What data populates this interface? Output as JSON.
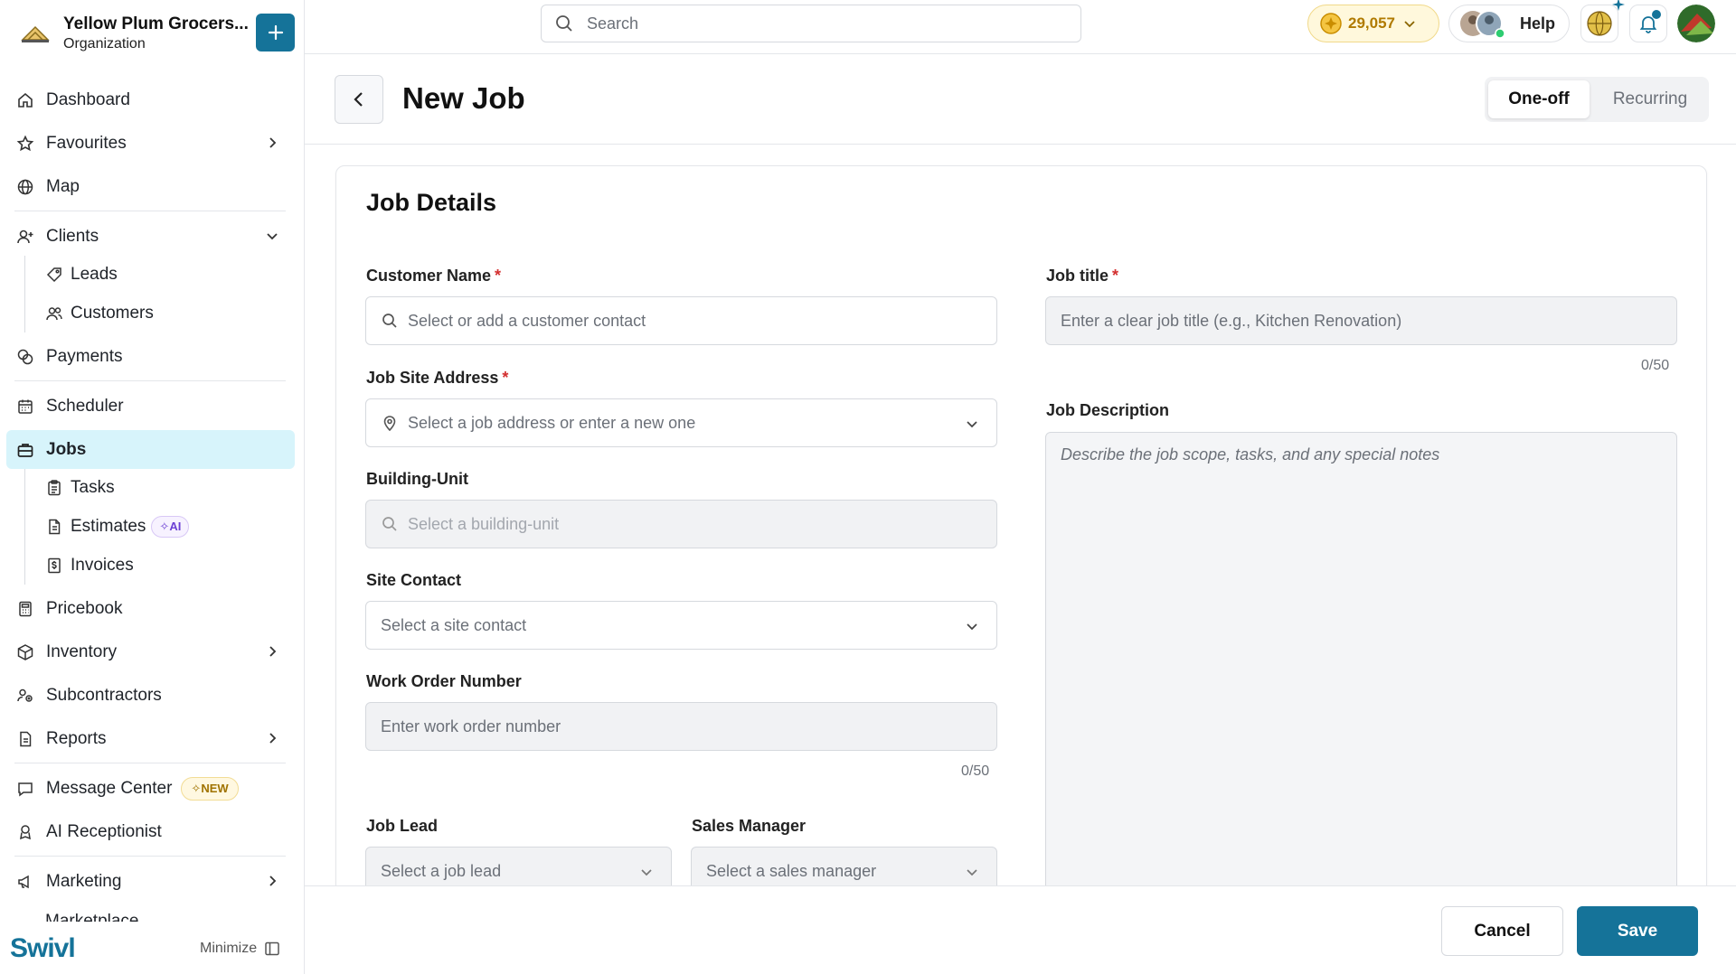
{
  "org": {
    "name": "Yellow Plum Grocers...",
    "subtitle": "Organization"
  },
  "sidebar": {
    "items": [
      {
        "label": "Dashboard",
        "icon": "home-icon"
      },
      {
        "label": "Favourites",
        "icon": "star-icon"
      },
      {
        "label": "Map",
        "icon": "globe-icon"
      },
      {
        "label": "Clients",
        "icon": "user-plus-icon"
      },
      {
        "label": "Leads",
        "icon": "tag-icon"
      },
      {
        "label": "Customers",
        "icon": "users-icon"
      },
      {
        "label": "Payments",
        "icon": "coins-icon"
      },
      {
        "label": "Scheduler",
        "icon": "calendar-icon"
      },
      {
        "label": "Jobs",
        "icon": "briefcase-icon"
      },
      {
        "label": "Tasks",
        "icon": "clipboard-icon"
      },
      {
        "label": "Estimates",
        "icon": "document-icon",
        "badge": "AI"
      },
      {
        "label": "Invoices",
        "icon": "invoice-icon"
      },
      {
        "label": "Pricebook",
        "icon": "calculator-icon"
      },
      {
        "label": "Inventory",
        "icon": "box-icon"
      },
      {
        "label": "Subcontractors",
        "icon": "people-icon"
      },
      {
        "label": "Reports",
        "icon": "report-icon"
      },
      {
        "label": "Message Center",
        "icon": "chat-icon",
        "badge": "NEW"
      },
      {
        "label": "AI Receptionist",
        "icon": "headset-icon"
      },
      {
        "label": "Marketing",
        "icon": "megaphone-icon"
      },
      {
        "label": "Marketplace",
        "icon": "store-icon"
      }
    ],
    "footer": {
      "brand": "Swivl",
      "minimize_label": "Minimize"
    }
  },
  "topbar": {
    "search_placeholder": "Search",
    "coins": "29,057",
    "help_label": "Help"
  },
  "header": {
    "title": "New Job",
    "toggle": {
      "options": [
        "One-off",
        "Recurring"
      ],
      "selected": "One-off"
    }
  },
  "form": {
    "section_title": "Job Details",
    "customer_name": {
      "label": "Customer Name",
      "placeholder": "Select or add a customer contact"
    },
    "job_site_address": {
      "label": "Job Site Address",
      "placeholder": "Select a job address or enter a new one"
    },
    "building_unit": {
      "label": "Building-Unit",
      "placeholder": "Select a building-unit"
    },
    "site_contact": {
      "label": "Site Contact",
      "placeholder": "Select a site contact"
    },
    "work_order_number": {
      "label": "Work Order Number",
      "placeholder": "Enter work order number",
      "counter": "0/50"
    },
    "job_lead": {
      "label": "Job Lead",
      "placeholder": "Select a job lead"
    },
    "sales_manager": {
      "label": "Sales Manager",
      "placeholder": "Select a sales manager"
    },
    "job_title": {
      "label": "Job title",
      "placeholder": "Enter a clear job title (e.g., Kitchen Renovation)",
      "counter": "0/50"
    },
    "job_description": {
      "label": "Job Description",
      "placeholder": "Describe the job scope, tasks, and any special notes"
    }
  },
  "footer": {
    "cancel_label": "Cancel",
    "save_label": "Save"
  },
  "colors": {
    "primary": "#157399",
    "active_nav": "#d7f4fb",
    "required": "#d32f2f",
    "coins": "#b07a00"
  }
}
